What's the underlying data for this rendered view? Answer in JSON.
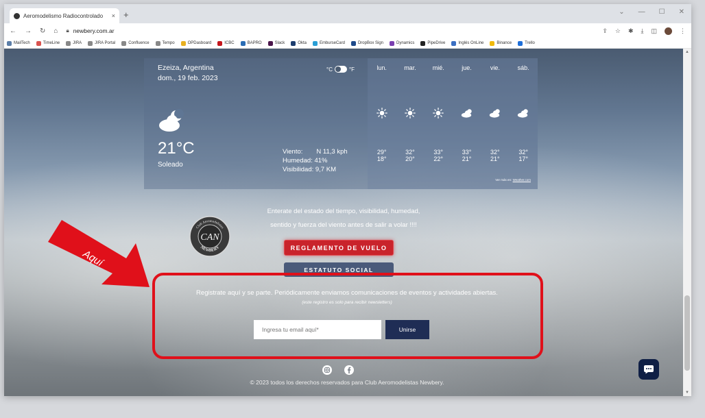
{
  "browser": {
    "tab_title": "Aeromodelismo Radiocontrolado",
    "tab_close": "×",
    "new_tab": "+",
    "url": "newbery.com.ar",
    "bookmarks": [
      {
        "label": "MailTech",
        "color": "#5b7ea8"
      },
      {
        "label": "TimeLine",
        "color": "#d9534f"
      },
      {
        "label": "JIRA",
        "color": "#888888"
      },
      {
        "label": "JIRA Portal",
        "color": "#888888"
      },
      {
        "label": "Confluence",
        "color": "#888888"
      },
      {
        "label": "Tempo",
        "color": "#888888"
      },
      {
        "label": "OPDasboard",
        "color": "#e8b020"
      },
      {
        "label": "ICBC",
        "color": "#c4161c"
      },
      {
        "label": "BAPRO",
        "color": "#2a6db5"
      },
      {
        "label": "Slack",
        "color": "#4a154b"
      },
      {
        "label": "Okta",
        "color": "#1c3d6e"
      },
      {
        "label": "EmburseCard",
        "color": "#2a9fd6"
      },
      {
        "label": "DropBox Sign",
        "color": "#1e4a8a"
      },
      {
        "label": "Dynamics",
        "color": "#7a3fb0"
      },
      {
        "label": "PipeDrive",
        "color": "#222222"
      },
      {
        "label": "Inglés OnLine",
        "color": "#3b6fc2"
      },
      {
        "label": "Binance",
        "color": "#f0b90b"
      },
      {
        "label": "Trello",
        "color": "#1e6fd9"
      }
    ]
  },
  "weather": {
    "city": "Ezeiza, Argentina",
    "date": "dom., 19 feb. 2023",
    "unit_c": "°C",
    "unit_f": "°F",
    "temp": "21°C",
    "condition": "Soleado",
    "wind_label": "Viento:",
    "wind_value": "N 11,3 kph",
    "humidity": "Humedad: 41%",
    "visibility": "Visibilidad: 9,7 KM",
    "more_prefix": "Ver más en:",
    "more_link": "Weather.com",
    "forecast": [
      {
        "day": "lun.",
        "icon": "sun",
        "hi": "29°",
        "lo": "18°"
      },
      {
        "day": "mar.",
        "icon": "sun",
        "hi": "32°",
        "lo": "20°"
      },
      {
        "day": "mié.",
        "icon": "sun",
        "hi": "33°",
        "lo": "22°"
      },
      {
        "day": "jue.",
        "icon": "cloud-sun",
        "hi": "33°",
        "lo": "21°"
      },
      {
        "day": "vie.",
        "icon": "cloud-sun",
        "hi": "32°",
        "lo": "21°"
      },
      {
        "day": "sáb.",
        "icon": "cloud-sun",
        "hi": "32°",
        "lo": "17°"
      }
    ]
  },
  "intro": {
    "line1": "Enterate del estado del tiempo, visibilidad, humedad,",
    "line2": "sentido y fuerza del viento antes de salir a volar !!!!"
  },
  "logo": {
    "text_top": "Club Aeromodelistas",
    "monogram": "CAN",
    "text_bottom": "NEWBERY"
  },
  "buttons": {
    "reglamento": "REGLAMENTO DE VUELO",
    "estatuto": "ESTATUTO SOCIAL"
  },
  "newsletter": {
    "text": "Registrate aquí y se parte. Periódicamente enviamos comunicaciones de eventos y actividades abiertas.",
    "note": "(este registro es solo para recibir newsletters)",
    "email_placeholder": "Ingresa tu email aquí*",
    "submit": "Unirse"
  },
  "annotation": {
    "arrow_label": "Aquí",
    "color": "#e0101a"
  },
  "footer": {
    "copyright": "© 2023 todos los derechos reservados para Club Aeromodelistas Newbery."
  }
}
